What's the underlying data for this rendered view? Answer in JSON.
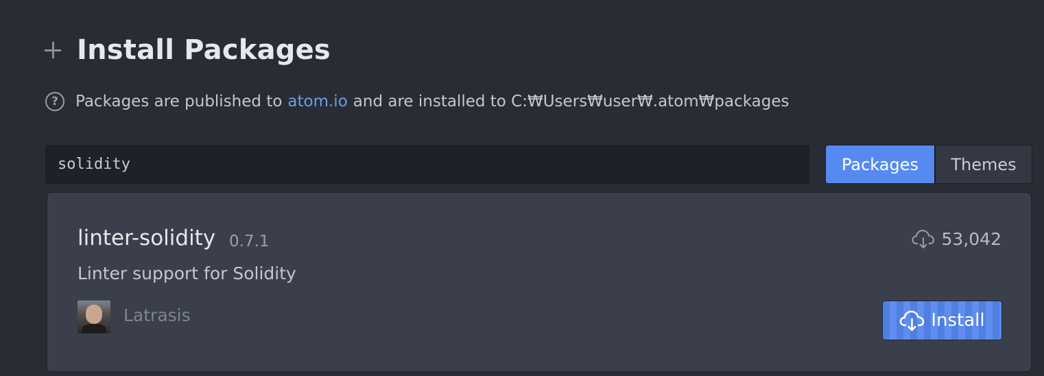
{
  "header": {
    "title": "Install Packages"
  },
  "info": {
    "prefix": "Packages are published to",
    "link_text": "atom.io",
    "suffix": "and are installed to C:₩Users₩user₩.atom₩packages"
  },
  "search": {
    "value": "solidity"
  },
  "tabs": {
    "packages_label": "Packages",
    "themes_label": "Themes",
    "selected": "Packages"
  },
  "package": {
    "name": "linter-solidity",
    "version": "0.7.1",
    "description": "Linter support for Solidity",
    "author": "Latrasis",
    "downloads": "53,042",
    "install_label": "Install"
  },
  "colors": {
    "background": "#282c34",
    "accent": "#568af2",
    "link": "#6d9de8",
    "card": "#3a3f4b"
  },
  "icons": {
    "header": "plus-icon",
    "info": "question-icon",
    "downloads": "cloud-download-icon",
    "install": "cloud-download-icon"
  }
}
